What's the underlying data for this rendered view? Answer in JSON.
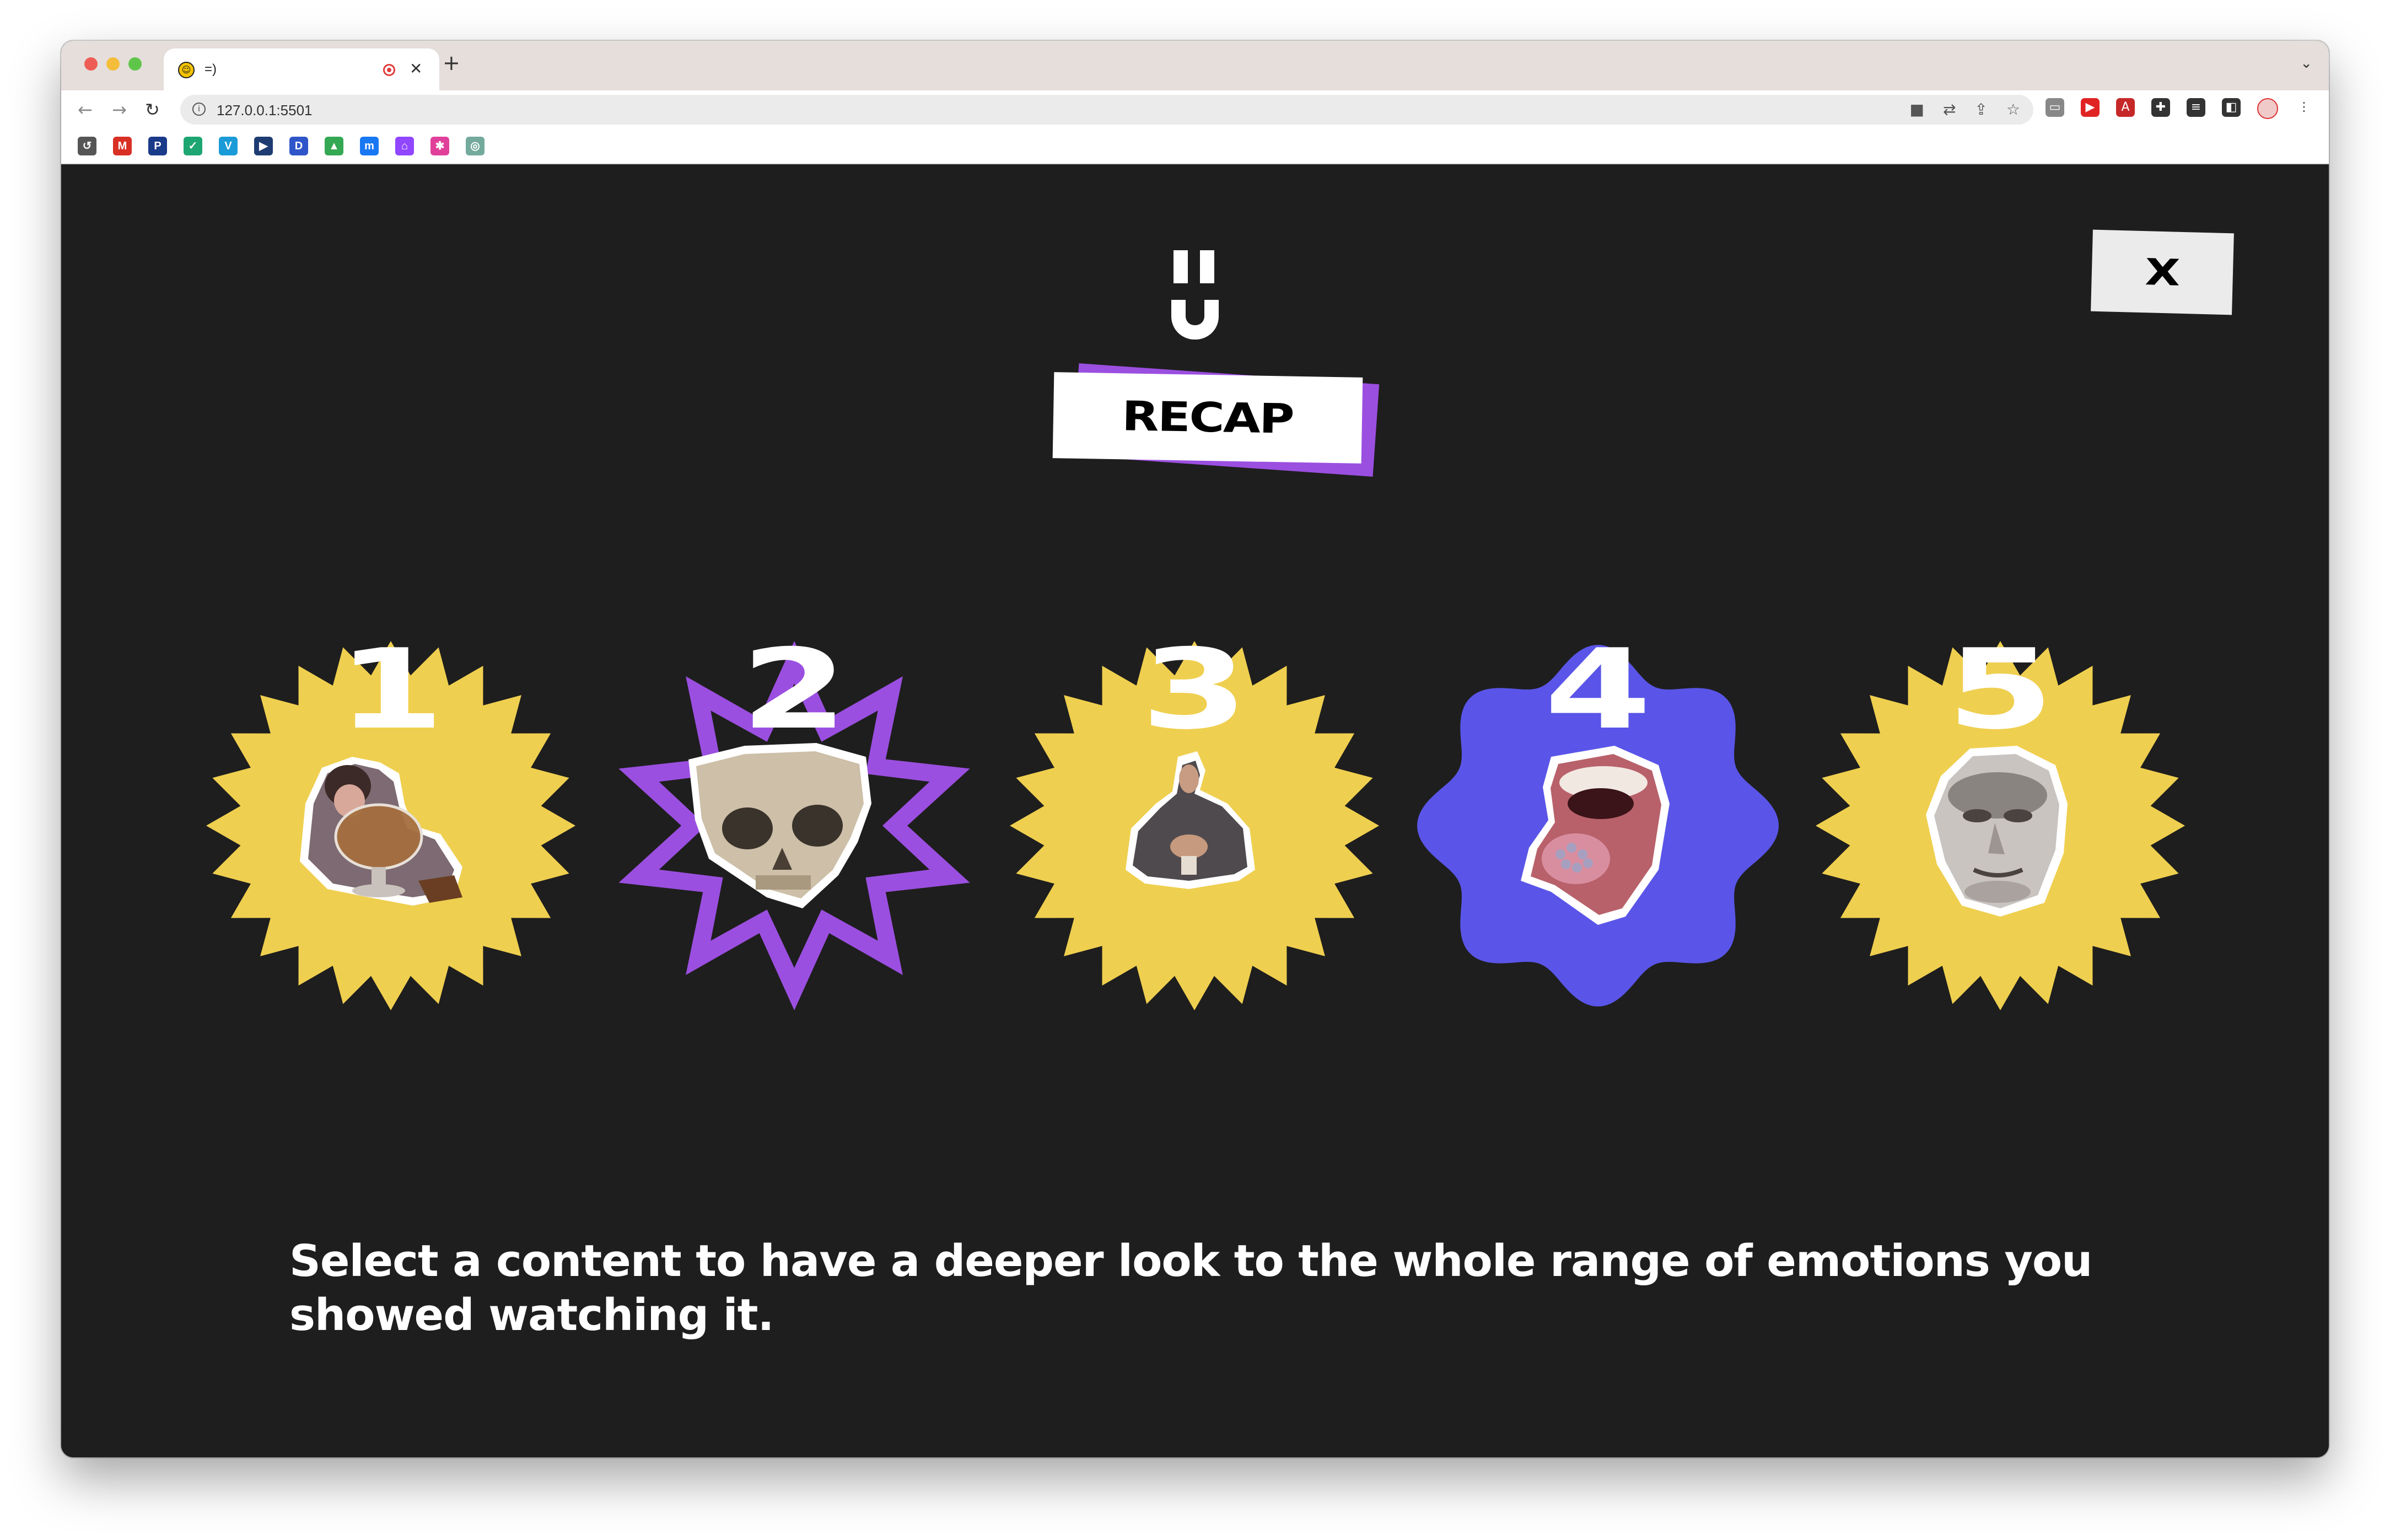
{
  "browser": {
    "tab": {
      "title": "=)",
      "favicon_icon": "smiley-icon"
    },
    "url": "127.0.0.1:5501",
    "nav_icons": {
      "back": "←",
      "forward": "→",
      "reload": "↻"
    },
    "omnibox_icons": [
      "camera-icon",
      "translate-icon",
      "share-icon",
      "star-icon"
    ],
    "extension_icons": [
      {
        "name": "cast-icon",
        "color": "#888888",
        "glyph": "▭"
      },
      {
        "name": "youtube-icon",
        "color": "#e02424",
        "glyph": "▶"
      },
      {
        "name": "pdf-icon",
        "color": "#c62828",
        "glyph": "A"
      },
      {
        "name": "puzzle-icon",
        "color": "#333333",
        "glyph": "✚"
      },
      {
        "name": "reading-list-icon",
        "color": "#333333",
        "glyph": "≡"
      },
      {
        "name": "side-panel-icon",
        "color": "#333333",
        "glyph": "◧"
      }
    ],
    "bookmarks": [
      {
        "name": "history-bookmark-icon",
        "color": "#555555",
        "glyph": "↺"
      },
      {
        "name": "gmail-bookmark-icon",
        "color": "#d93025",
        "glyph": "M"
      },
      {
        "name": "pl-bookmark-icon",
        "color": "#1a3a8a",
        "glyph": "P"
      },
      {
        "name": "check-bookmark-icon",
        "color": "#1ea672",
        "glyph": "✓"
      },
      {
        "name": "v-bookmark-icon",
        "color": "#1a9bd7",
        "glyph": "V"
      },
      {
        "name": "play-bookmark-icon",
        "color": "#1e3c72",
        "glyph": "▶"
      },
      {
        "name": "d-bookmark-icon",
        "color": "#2f56c9",
        "glyph": "D"
      },
      {
        "name": "drive-bookmark-icon",
        "color": "#34a853",
        "glyph": "▲"
      },
      {
        "name": "m-bookmark-icon",
        "color": "#1877f2",
        "glyph": "m"
      },
      {
        "name": "twitch-bookmark-icon",
        "color": "#9146ff",
        "glyph": "⌂"
      },
      {
        "name": "pink-bookmark-icon",
        "color": "#e0409a",
        "glyph": "✱"
      },
      {
        "name": "gpt-bookmark-icon",
        "color": "#74aa9c",
        "glyph": "◎"
      }
    ]
  },
  "app": {
    "logo_icon": "smiley-logo-icon",
    "title": "RECAP",
    "close_label": "X",
    "caption": "Select a content to have a deeper look to the whole range of emotions you showed watching it.",
    "colors": {
      "background": "#1e1e1e",
      "yellow": "#efcf4f",
      "purple": "#9b4fe0",
      "blue": "#5a55e8"
    },
    "contents": [
      {
        "number": "1",
        "badge_shape": "sawtooth",
        "color": "#efcf4f",
        "image": "woman-with-giant-glass"
      },
      {
        "number": "2",
        "badge_shape": "star-outline",
        "color": "#9b4fe0",
        "image": "skull"
      },
      {
        "number": "3",
        "badge_shape": "sawtooth",
        "color": "#efcf4f",
        "image": "man-with-cup"
      },
      {
        "number": "4",
        "badge_shape": "wavy",
        "color": "#5a55e8",
        "image": "open-mouth-tongue"
      },
      {
        "number": "5",
        "badge_shape": "sawtooth",
        "color": "#efcf4f",
        "image": "winston-churchill-face"
      }
    ]
  }
}
